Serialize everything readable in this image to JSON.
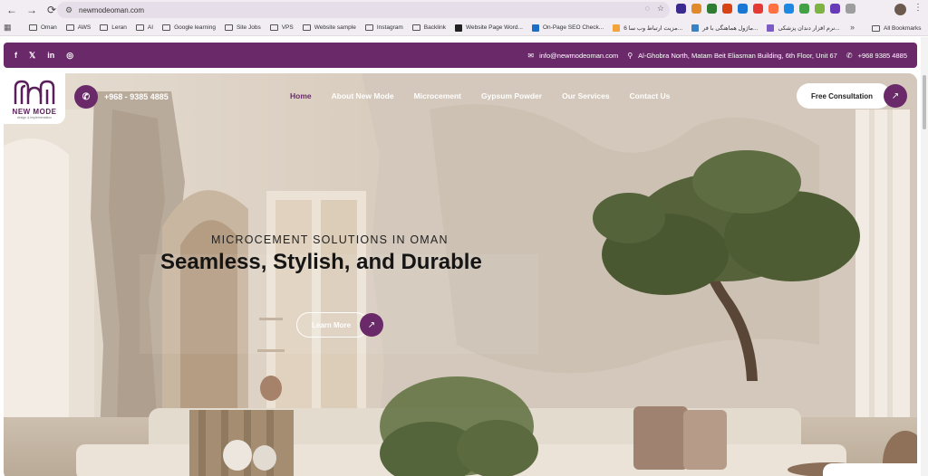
{
  "browser": {
    "url": "newmodeoman.com",
    "bookmarks": [
      {
        "label": "Oman",
        "type": "folder"
      },
      {
        "label": "AWS",
        "type": "folder"
      },
      {
        "label": "Leran",
        "type": "folder"
      },
      {
        "label": "AI",
        "type": "folder"
      },
      {
        "label": "Google learning",
        "type": "folder"
      },
      {
        "label": "Site Jobs",
        "type": "folder"
      },
      {
        "label": "VPS",
        "type": "folder"
      },
      {
        "label": "Website sample",
        "type": "folder"
      },
      {
        "label": "Instagram",
        "type": "folder"
      },
      {
        "label": "Backlink",
        "type": "folder"
      },
      {
        "label": "Website Page Word...",
        "type": "site",
        "color": "#222222"
      },
      {
        "label": "On-Page SEO Check...",
        "type": "site",
        "color": "#1c6fc4"
      },
      {
        "label": "6 مزیت ارتباط وب سا...",
        "type": "site",
        "color": "#f2a33a"
      },
      {
        "label": "ماژول هماهنگی با فر...",
        "type": "site",
        "color": "#3b82c4"
      },
      {
        "label": "نرم افزار دندان پزشکی...",
        "type": "site",
        "color": "#7c5cc4"
      }
    ],
    "all_bookmarks": "All Bookmarks",
    "extension_colors": [
      "#3b2a8f",
      "#e08a2c",
      "#2e7d32",
      "#d84315",
      "#1976d2",
      "#e53935",
      "#ff7043",
      "#1e88e5",
      "#43a047",
      "#7cb342",
      "#673ab7",
      "#9e9e9e"
    ]
  },
  "topbar": {
    "social": [
      "f",
      "𝕏",
      "in",
      "◎"
    ],
    "email": "info@newmodeoman.com",
    "address": "Al-Ghobra North, Matam Beit Eliasman Building, 6th Floor, Unit 67",
    "phone": "+968 9385 4885"
  },
  "logo": {
    "name": "NEW MODE",
    "tagline": "design & implementation"
  },
  "header": {
    "phone": "+968 - 9385 4885",
    "nav": [
      {
        "label": "Home",
        "active": true
      },
      {
        "label": "About New Mode",
        "active": false
      },
      {
        "label": "Microcement",
        "active": false
      },
      {
        "label": "Gypsum Powder",
        "active": false
      },
      {
        "label": "Our Services",
        "active": false
      },
      {
        "label": "Contact Us",
        "active": false
      }
    ],
    "cta": "Free Consultation"
  },
  "hero": {
    "eyebrow": "MICROCEMENT SOLUTIONS IN OMAN",
    "headline": "Seamless, Stylish, and Durable",
    "button": "Learn More"
  },
  "colors": {
    "brand": "#6a2a6a",
    "chrome": "#f1edf3"
  }
}
